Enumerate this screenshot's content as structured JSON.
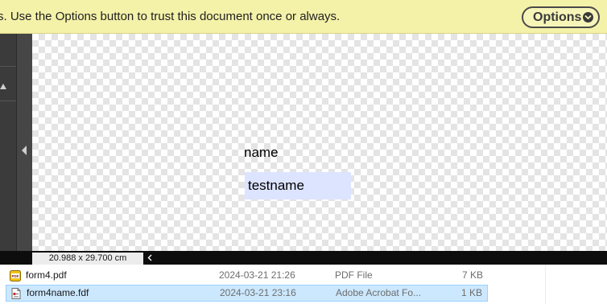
{
  "banner": {
    "message": "s. Use the Options button to trust this document once or always.",
    "options_label": "Options"
  },
  "form": {
    "field_label": "name",
    "field_value": "testname"
  },
  "status_bar": {
    "page_size": "20.988 x 29.700 cm"
  },
  "files": [
    {
      "name": "form4.pdf",
      "date": "2024-03-21 21:26",
      "type": "PDF File",
      "size": "7 KB",
      "icon": "pdf-file-icon",
      "selected": false
    },
    {
      "name": "form4name.fdf",
      "date": "2024-03-21 23:16",
      "type": "Adobe Acrobat Fo...",
      "size": "1 KB",
      "icon": "fdf-file-icon",
      "selected": true
    }
  ],
  "colors": {
    "banner_bg": "#f4f1a9",
    "field_highlight": "#dde4ff",
    "selection_bg": "#cce8ff"
  }
}
